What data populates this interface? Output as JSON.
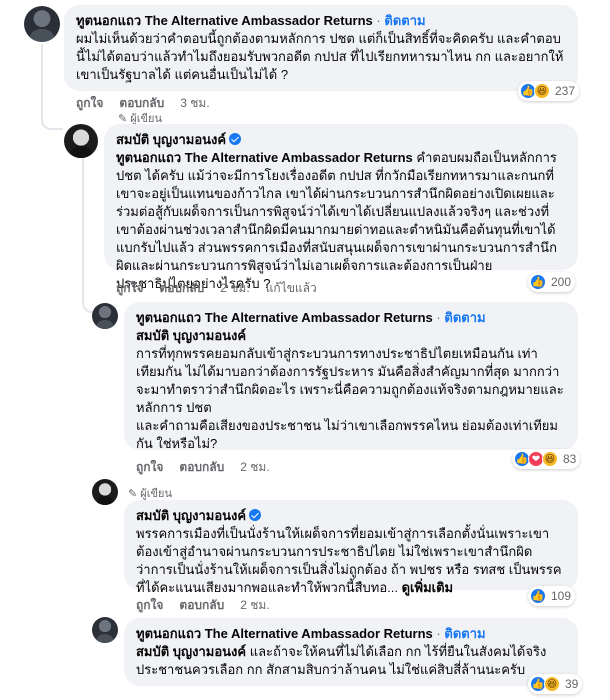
{
  "c1": {
    "author": "ทูตนอกแถว The Alternative Ambassador Returns",
    "follow": "ติดตาม",
    "sep": "·",
    "text": "ผมไม่เห็นด้วยว่าคำตอบนี้ถูกต้องตามหลักการ ปชต แต่ก็เป็นสิทธิ์ที่จะคิดครับ และคำตอบนี้ไม่ได้ตอบว่าแล้วทำไมถึงยอมรับพวกอดีต กปปส ที่ไปเรียกทหารมาไหน กก และอยากให้เขาเป็นรัฐบาลได้ แต่คนอื่นเป็นไม่ได้ ?",
    "like": "ถูกใจ",
    "reply": "ตอบกลับ",
    "time": "3 ชม.",
    "reaction_count": "237"
  },
  "c2": {
    "badge": "ผู้เขียน",
    "author": "สมบัติ บุญงามอนงค์",
    "mention": "ทูตนอกแถว The Alternative Ambassador Returns",
    "text": " คำตอบผมถือเป็นหลักการ ปชต ได้ครับ แม้ว่าจะมีการโยงเรื่องอดีต กปปส ที่กวักมือเรียกทหารมาและกนกที่เขาจะอยู่เป็นแทนของก้าวไกล เขาได้ผ่านกระบวนการสำนึกผิดอย่างเปิดเผยและร่วมต่อสู้กับเผด็จการเป็นการพิสูจน์ว่าได้เขาได้เปลี่ยนแปลงแล้วจริงๆ และช่วงที่เขาต้องผ่านช่วงเวลาสำนึกผิดมีคนมากมายด่าทอและตำหนิมันคือต้นทุนที่เขาได้แบกรับไปแล้ว ส่วนพรรคการเมืองที่สนับสนุนเผด็จการเขาผ่านกระบวนการสำนึกผิดและผ่านกระบวนการพิสูจน์ว่าไม่เอาเผด็จการและต้องการเป็นฝ่ายประชาธิปไตยอย่างไรครับ ?",
    "like": "ถูกใจ",
    "reply": "ตอบกลับ",
    "time": "2 ชม.",
    "edited": "แก้ไขแล้ว",
    "reaction_count": "200"
  },
  "c3": {
    "author": "ทูตนอกแถว The Alternative Ambassador Returns",
    "follow": "ติดตาม",
    "sep": "·",
    "mention": "สมบัติ บุญงามอนงค์",
    "text": "การที่ทุกพรรคยอมกลับเข้าสู่กระบวนการทางประชาธิปไตยเหมือนกัน เท่าเทียมกัน ไม่ได้มาบอกว่าต้องการรัฐประหาร มันคือสิ่งสำคัญมากที่สุด มากกว่าจะมาทำตราว่าสำนึกผิดอะไร เพราะนี่คือความถูกต้องแท้จริงตามกฎหมายและหลักการ ปชต\nและคำถามคือเสียงของประชาชน ไม่ว่าเขาเลือกพรรคไหน ย่อมต้องเท่าเทียมกัน ใช่หรือไม่?",
    "like": "ถูกใจ",
    "reply": "ตอบกลับ",
    "time": "2 ชม.",
    "reaction_count": "83"
  },
  "c4": {
    "badge": "ผู้เขียน",
    "author": "สมบัติ บุญงามอนงค์",
    "text": "พรรคการเมืองที่เป็นนั่งร้านให้เผด็จการที่ยอมเข้าสู่การเลือกตั้งนั่นเพราะเขาต้องเข้าสู่อำนาจผ่านกระบวนการประชาธิปไตย ไม่ใช่เพราะเขาสำนึกผิดว่าการเป็นนั่งร้านให้เผด็จการเป็นสิ่งไม่ถูกต้อง ถ้า พปชร หรือ รทสช เป็นพรรคที่ได้คะแนนเสียงมากพอและทำให้พวกนี้สืบทอ...",
    "see_more": "ดูเพิ่มเติม",
    "like": "ถูกใจ",
    "reply": "ตอบกลับ",
    "time": "2 ชม.",
    "reaction_count": "109"
  },
  "c5": {
    "author": "ทูตนอกแถว The Alternative Ambassador Returns",
    "follow": "ติดตาม",
    "sep": "·",
    "mention": "สมบัติ บุญงามอนงค์",
    "text": " และถ้าจะให้คนที่ไม่ได้เลือก กก ไร้ที่ยืนในสังคมได้จริง ประชาชนควรเลือก กก สักสามสิบกว่าล้านคน ไม่ใช่แค่สิบสี่ล้านนะครับ",
    "reaction_count": "39"
  },
  "colors": {
    "link": "#1877f2",
    "bubble": "#f0f2f5",
    "muted": "#65676b"
  },
  "icons": [
    "avatar",
    "verified-badge-icon",
    "pen-icon",
    "like-reaction-icon",
    "love-reaction-icon",
    "haha-reaction-icon",
    "more-options-icon"
  ]
}
